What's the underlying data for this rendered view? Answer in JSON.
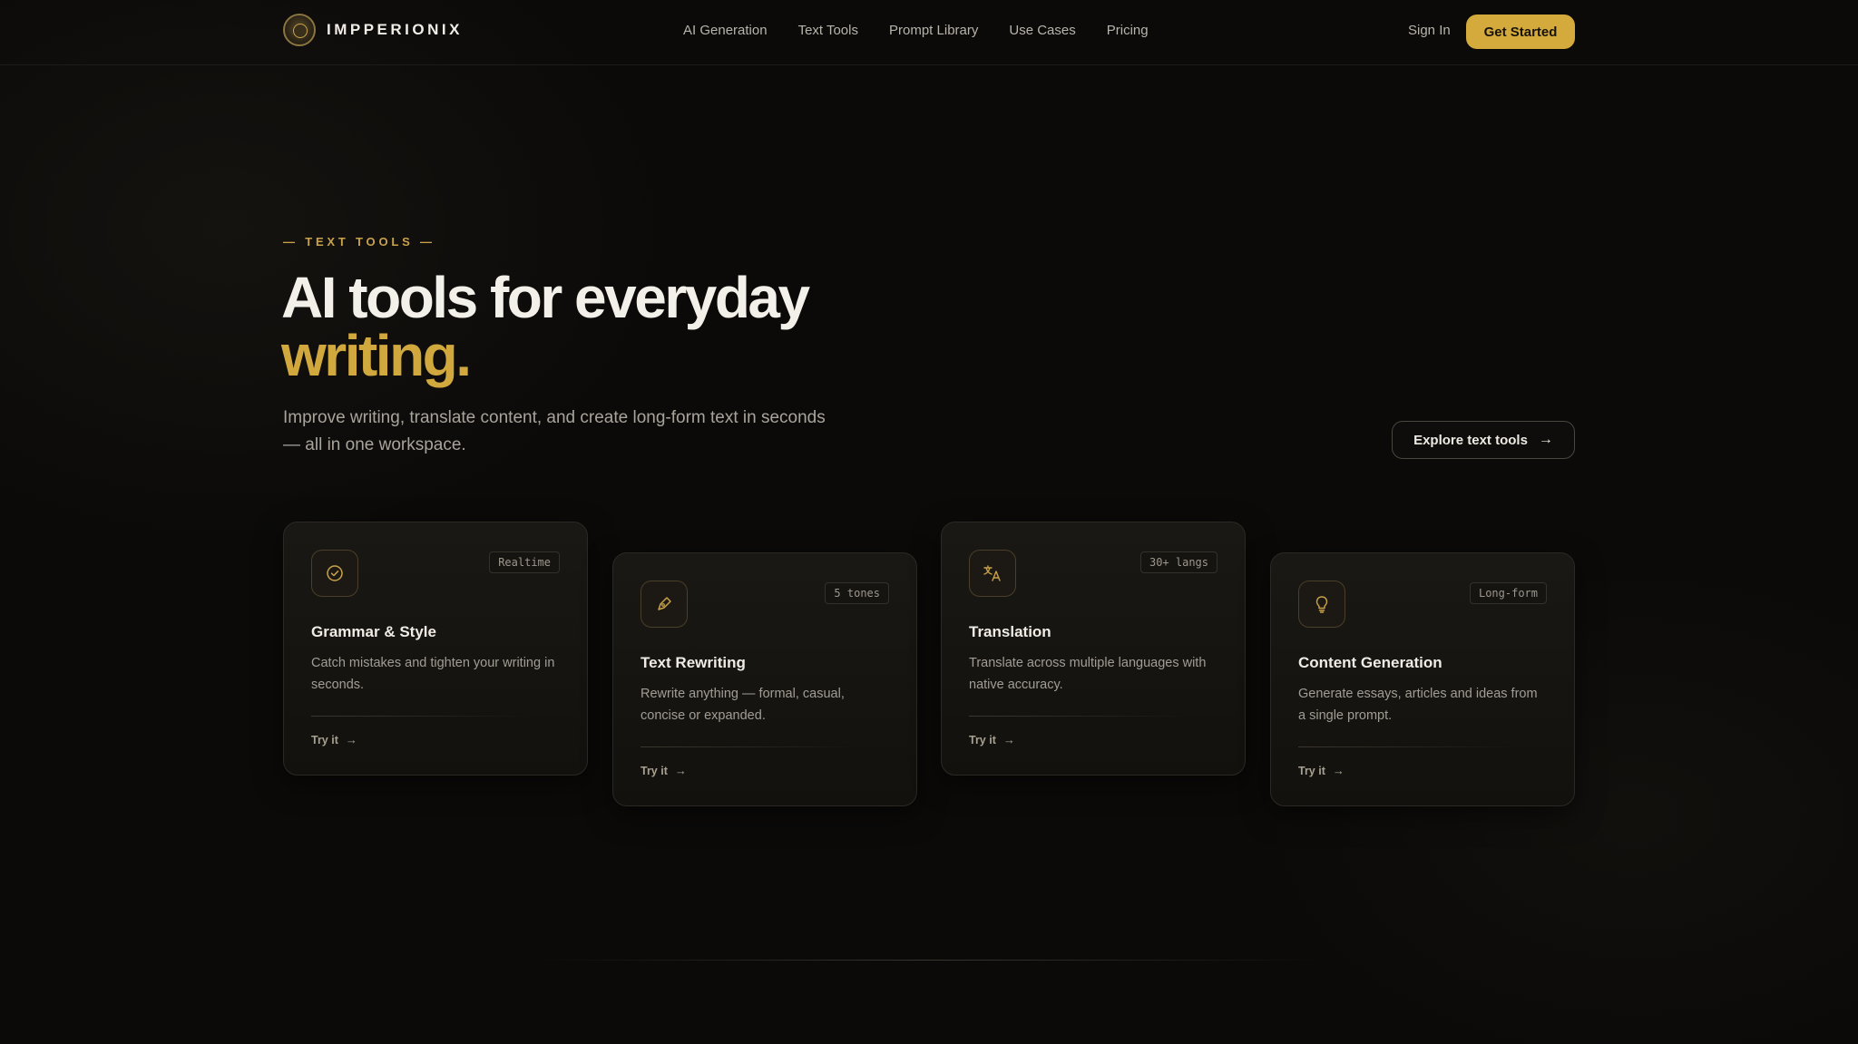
{
  "brand": {
    "name": "IMPPERIONIX"
  },
  "nav": {
    "links": [
      "AI Generation",
      "Text Tools",
      "Prompt Library",
      "Use Cases",
      "Pricing"
    ],
    "sign_in": "Sign In",
    "cta": "Get Started"
  },
  "hero": {
    "eyebrow": "— TEXT TOOLS —",
    "title_line1": "AI tools for everyday",
    "title_line2": "writing.",
    "subtitle": "Improve writing, translate content, and create long-form text in seconds — all in one workspace.",
    "explore_label": "Explore text tools"
  },
  "cards": [
    {
      "title": "Grammar & Style",
      "badge": "Realtime",
      "desc": "Catch mistakes and tighten your writing in seconds.",
      "link": "Try it",
      "icon": "check-circle-icon"
    },
    {
      "title": "Text Rewriting",
      "badge": "5 tones",
      "desc": "Rewrite anything — formal, casual, concise or expanded.",
      "link": "Try it",
      "icon": "pen-icon"
    },
    {
      "title": "Translation",
      "badge": "30+ langs",
      "desc": "Translate across multiple languages with native accuracy.",
      "link": "Try it",
      "icon": "translate-icon"
    },
    {
      "title": "Content Generation",
      "badge": "Long-form",
      "desc": "Generate essays, articles and ideas from a single prompt.",
      "link": "Try it",
      "icon": "lightbulb-icon"
    }
  ],
  "colors": {
    "accent": "#d4aa3c",
    "background": "#0b0a09"
  }
}
